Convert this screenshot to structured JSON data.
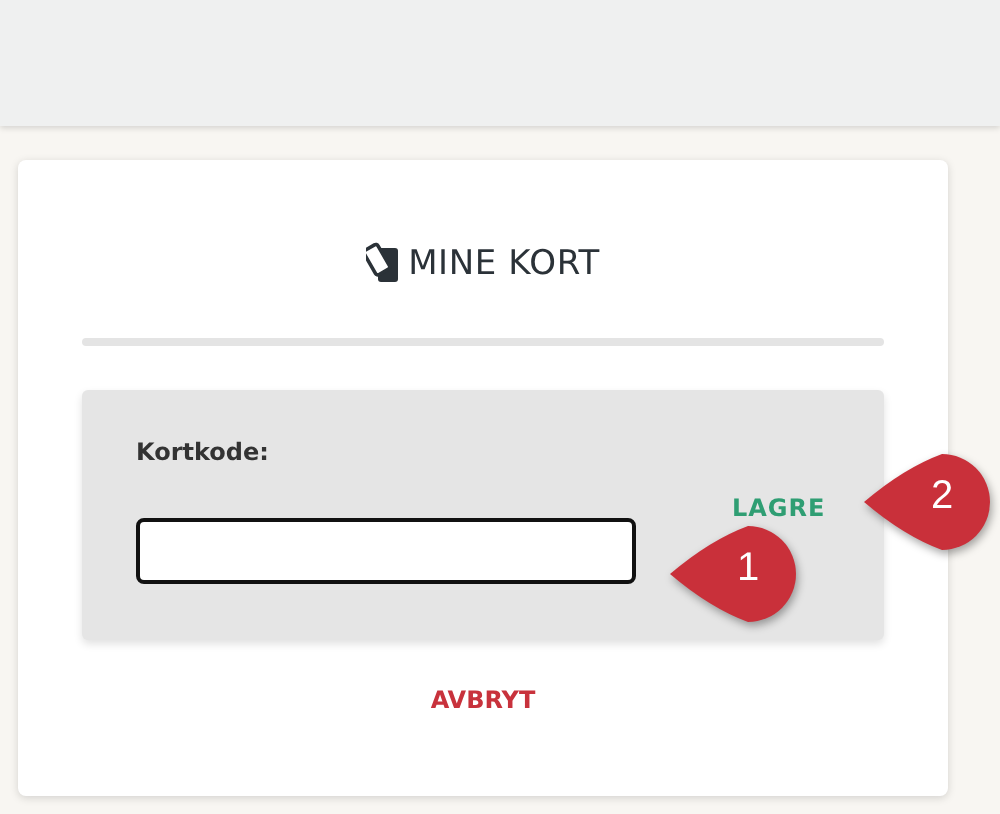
{
  "card": {
    "title": "MINE KORT",
    "form": {
      "label": "Kortkode:",
      "input": {
        "callout": "1"
      },
      "save_button": {
        "label": "LAGRE",
        "callout": "2"
      }
    },
    "cancel_button": "AVBRYT"
  }
}
